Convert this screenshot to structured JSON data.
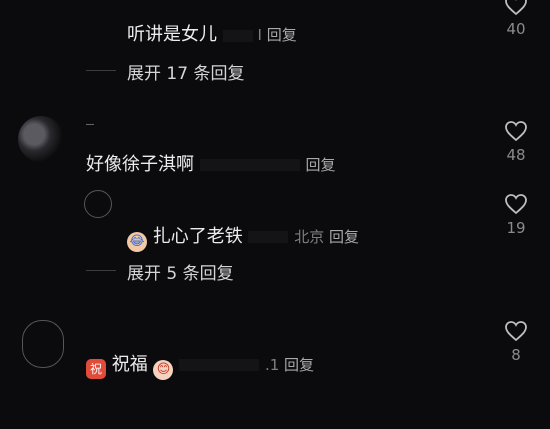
{
  "comments": [
    {
      "text": "听讲是女儿",
      "meta_tail": "I",
      "reply": "回复",
      "likes": "40"
    },
    {
      "expand": "展开 17 条回复"
    },
    {
      "text": "好像徐子淇啊",
      "reply": "回复",
      "likes": "48"
    },
    {
      "text": "扎心了老铁",
      "location": "北京",
      "reply": "回复",
      "likes": "19"
    },
    {
      "expand": "展开 5 条回复"
    },
    {
      "text_prefix_icon": "祝",
      "text": "祝福",
      "meta_tail": ".1",
      "reply": "回复",
      "likes": "8"
    }
  ],
  "icons": {
    "like": "heart-outline-icon",
    "cry": "crying-face-icon",
    "zhu": "zhu-sticker-icon",
    "baby": "baby-face-icon"
  },
  "colors": {
    "background": "#0b0b0d",
    "text": "#ececee",
    "meta": "#7d7d84"
  }
}
